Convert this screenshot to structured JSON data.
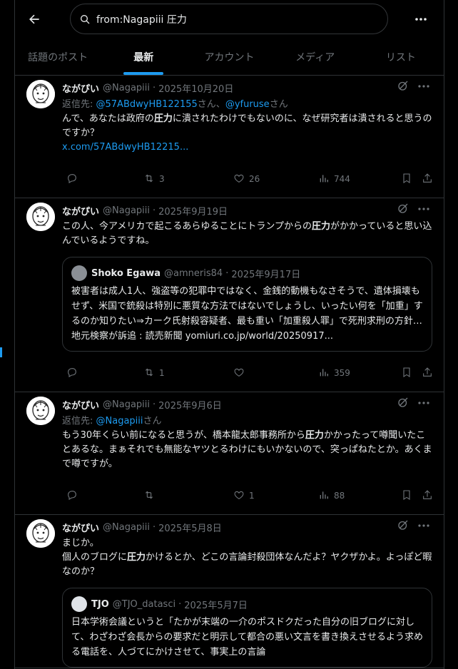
{
  "search": {
    "query": "from:Nagapiii 圧力"
  },
  "tabs": [
    "話題のポスト",
    "最新",
    "アカウント",
    "メディア",
    "リスト"
  ],
  "reply_prefix": "返信先: ",
  "reply_suffix": "さん",
  "reply_join": "、",
  "posts": [
    {
      "name": "ながぴい",
      "handle": "@Nagapiii",
      "date": "2025年10月20日",
      "reply_to": [
        "@57ABdwyHB122155",
        "@yfuruse"
      ],
      "text_parts": [
        "んで、あなたは政府の",
        "圧力",
        "に潰されたわけでもないのに、なぜ研究者は潰されると思うのですか？"
      ],
      "link": "x.com/57ABdwyHB12215...",
      "retweets": "3",
      "likes": "26",
      "views": "744"
    },
    {
      "name": "ながぴい",
      "handle": "@Nagapiii",
      "date": "2025年9月19日",
      "text_parts": [
        "この人、今アメリカで起こるあらゆることにトランプからの",
        "圧力",
        "がかかっていると思い込んでいるようですね。"
      ],
      "quote": {
        "name": "Shoko Egawa",
        "handle": "@amneris84",
        "date": "2025年9月17日",
        "text": "被害者は成人1人、強盗等の犯罪中ではなく、金銭的動機もなさそうで、遺体損壊もせず、米国で銃殺は特別に悪質な方法ではないでしょうし、いったい何を「加重」するのか知りたい⇒カーク氏射殺容疑者、最も重い「加重殺人罪」で死刑求刑の方針…地元検察が訴追 : 読売新聞 yomiuri.co.jp/world/20250917..."
      },
      "retweets": "1",
      "likes": "",
      "views": "359"
    },
    {
      "name": "ながぴい",
      "handle": "@Nagapiii",
      "date": "2025年9月6日",
      "reply_to": [
        "@Nagapiii"
      ],
      "text_parts": [
        "もう30年くらい前になると思うが、橋本龍太郎事務所から",
        "圧力",
        "かかったって噂聞いたことあるな。まぁそれでも無能なヤツとるわけにもいかないので、突っぱねたとか。あくまで噂ですが。"
      ],
      "retweets": "",
      "likes": "1",
      "views": "88"
    },
    {
      "name": "ながぴい",
      "handle": "@Nagapiii",
      "date": "2025年5月8日",
      "text_parts": [
        "まじか。",
        "個人のブログに",
        "圧力",
        "かけるとか、どこの言論封殺団体なんだよ？ヤクザかよ。よっぽど暇なのか？"
      ],
      "quote": {
        "name": "TJO",
        "handle": "@TJO_datasci",
        "date": "2025年5月7日",
        "text": "日本学術会議というと「たかが末端の一介のポスドクだった自分の旧ブログに対して、わざわざ会長からの要求だと明示して都合の悪い文言を書き換えさせるよう求める電話を、人づてにかけさせて、事実上の言論"
      }
    }
  ],
  "colors": {
    "accent": "#1d9bf0",
    "text": "#e7e9ea",
    "muted": "#71767b",
    "border": "#2f3336"
  }
}
